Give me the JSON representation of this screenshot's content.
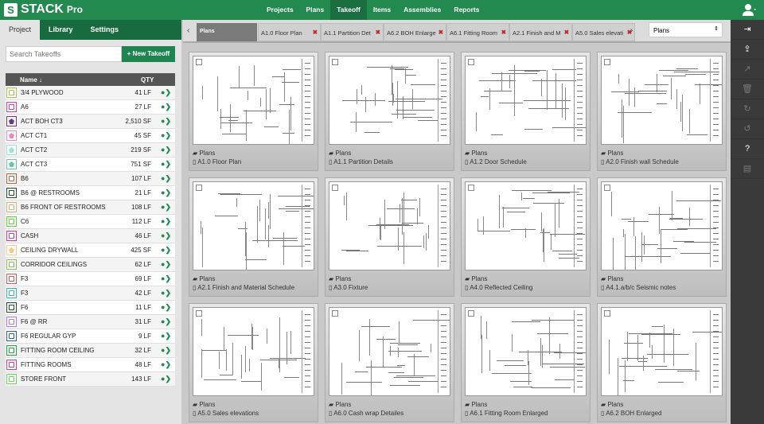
{
  "app": {
    "name": "STACK",
    "edition": "Pro"
  },
  "nav": [
    "Projects",
    "Plans",
    "Takeoff",
    "Items",
    "Assemblies",
    "Reports"
  ],
  "nav_active": "Takeoff",
  "left_tabs": [
    "Project",
    "Library",
    "Settings"
  ],
  "search": {
    "placeholder": "Search Takeoffs"
  },
  "new_takeoff": "+ New Takeoff",
  "list_header": {
    "name": "Name ↓",
    "qty": "QTY"
  },
  "takeoffs": [
    {
      "name": "3/4 PLYWOOD",
      "qty": "41 LF",
      "color": "#a9c35a",
      "fill": false
    },
    {
      "name": "A6",
      "qty": "27 LF",
      "color": "#e0419a",
      "fill": false
    },
    {
      "name": "ACT BOH CT3",
      "qty": "2,510 SF",
      "color": "#6a3a86",
      "fill": true
    },
    {
      "name": "ACT CT1",
      "qty": "45 SF",
      "color": "#e48ab8",
      "fill": true
    },
    {
      "name": "ACT CT2",
      "qty": "219 SF",
      "color": "#9ee0d2",
      "fill": true
    },
    {
      "name": "ACT CT3",
      "qty": "751 SF",
      "color": "#6cc3a5",
      "fill": true
    },
    {
      "name": "B6",
      "qty": "107 LF",
      "color": "#a9673a",
      "fill": false
    },
    {
      "name": "B6 @ RESTROOMS",
      "qty": "21 LF",
      "color": "#1f4d2a",
      "fill": false
    },
    {
      "name": "B6 FRONT OF RESTROOMS",
      "qty": "108 LF",
      "color": "#d2b47a",
      "fill": false
    },
    {
      "name": "C6",
      "qty": "112 LF",
      "color": "#5cd43a",
      "fill": false
    },
    {
      "name": "CASH",
      "qty": "46 LF",
      "color": "#d93a92",
      "fill": false
    },
    {
      "name": "CEILING DRYWALL",
      "qty": "425 SF",
      "color": "#f7c98a",
      "fill": true
    },
    {
      "name": "CORRIDOR CEILINGS",
      "qty": "62 LF",
      "color": "#8dbb5a",
      "fill": false
    },
    {
      "name": "F3",
      "qty": "69 LF",
      "color": "#c4605a",
      "fill": false
    },
    {
      "name": "F3",
      "qty": "42 LF",
      "color": "#3ab8b0",
      "fill": false
    },
    {
      "name": "F6",
      "qty": "11 LF",
      "color": "#1f4d2a",
      "fill": false
    },
    {
      "name": "F6 @ RR",
      "qty": "31 LF",
      "color": "#b27ae0",
      "fill": false
    },
    {
      "name": "F6 REGULAR GYP",
      "qty": "9 LF",
      "color": "#2a5cb8",
      "fill": false
    },
    {
      "name": "FITTING ROOM CEILING",
      "qty": "32 LF",
      "color": "#22a83a",
      "fill": false
    },
    {
      "name": "FITTING ROOMS",
      "qty": "48 LF",
      "color": "#d93a8a",
      "fill": false
    },
    {
      "name": "STORE FRONT",
      "qty": "143 LF",
      "color": "#6cd85a",
      "fill": false
    }
  ],
  "plan_tabs": {
    "active": "Plans",
    "tabs": [
      "A1.0 Floor Plan",
      "A1.1 Partition Det",
      "A6.2 BOH Enlarge",
      "A6.1 Fitting Room",
      "A2.1 Finish and M",
      "A5.0 Sales elevati"
    ]
  },
  "plans_select": "Plans",
  "sheets": [
    {
      "folder": "Plans",
      "name": "A1.0 Floor Plan"
    },
    {
      "folder": "Plans",
      "name": "A1.1 Partition Details"
    },
    {
      "folder": "Plans",
      "name": "A1.2 Door Schedule"
    },
    {
      "folder": "Plans",
      "name": "A2.0 Finish wall Schedule"
    },
    {
      "folder": "Plans",
      "name": "A2.1 Finish and Material Schedule"
    },
    {
      "folder": "Plans",
      "name": "A3.0 Fixture"
    },
    {
      "folder": "Plans",
      "name": "A4.0 Reflected Ceiling"
    },
    {
      "folder": "Plans",
      "name": "A4.1.a/b/c Seismic notes"
    },
    {
      "folder": "Plans",
      "name": "A5.0 Sales elevations"
    },
    {
      "folder": "Plans",
      "name": "A6.0 Cash wrap Detailes"
    },
    {
      "folder": "Plans",
      "name": "A6.1 Fitting Room Enlarged"
    },
    {
      "folder": "Plans",
      "name": "A6.2 BOH Enlarged"
    }
  ],
  "right_tools": [
    {
      "icon": "sign-in-icon",
      "glyph": "⇥",
      "enabled": true
    },
    {
      "icon": "upload-icon",
      "glyph": "⇪",
      "enabled": true
    },
    {
      "icon": "share-icon",
      "glyph": "↗",
      "enabled": false
    },
    {
      "icon": "trash-icon",
      "glyph": "🗑",
      "enabled": false
    },
    {
      "icon": "redo-icon",
      "glyph": "↻",
      "enabled": false
    },
    {
      "icon": "undo-icon",
      "glyph": "↺",
      "enabled": false
    },
    {
      "icon": "help-icon",
      "glyph": "?",
      "enabled": true
    },
    {
      "icon": "pdf-icon",
      "glyph": "▤",
      "enabled": false
    }
  ]
}
